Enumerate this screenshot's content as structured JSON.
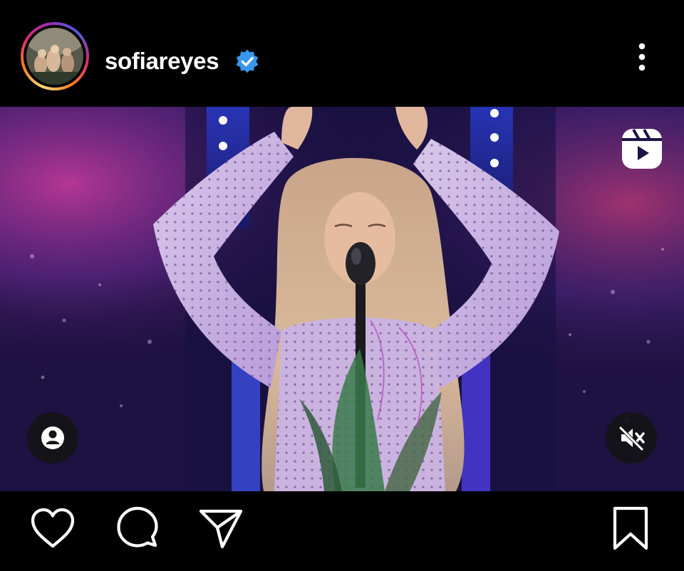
{
  "post": {
    "username": "sofiareyes",
    "verified": true,
    "media_type": "reel"
  },
  "icons": {
    "avatar": "profile-avatar",
    "verified": "verified-badge-icon",
    "more": "more-options-icon",
    "reel": "reels-icon",
    "tags": "user-tags-icon",
    "mute": "muted-speaker-icon",
    "like": "heart-icon",
    "comment": "comment-icon",
    "share": "paper-plane-icon",
    "save": "bookmark-icon"
  },
  "colors": {
    "background": "#000000",
    "verified_blue": "#3897f0",
    "icon": "#ffffff"
  }
}
